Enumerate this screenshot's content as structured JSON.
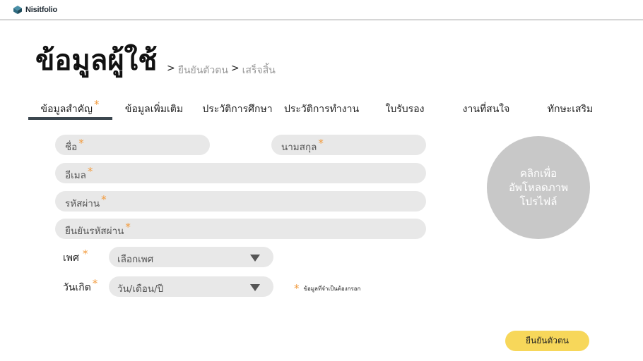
{
  "header": {
    "brand": "Nisitfolio"
  },
  "page": {
    "title": "ข้อมูลผู้ใช้",
    "breadcrumb": {
      "sep1": ">",
      "step1": "ยืนยันตัวตน",
      "sep2": ">",
      "step2": "เสร็จสิ้น"
    }
  },
  "tabs": [
    {
      "label": "ข้อมูลสำคัญ",
      "required": "*"
    },
    {
      "label": "ข้อมูลเพิ่มเติม"
    },
    {
      "label": "ประวัติการศึกษา"
    },
    {
      "label": "ประวัติการทำงาน"
    },
    {
      "label": "ใบรับรอง"
    },
    {
      "label": "งานที่สนใจ"
    },
    {
      "label": "ทักษะเสริม"
    }
  ],
  "form": {
    "first_name": {
      "placeholder": "ชื่อ"
    },
    "last_name": {
      "placeholder": "นามสกุล"
    },
    "email": {
      "placeholder": "อีเมล"
    },
    "password": {
      "placeholder": "รหัสผ่าน"
    },
    "confirm_password": {
      "placeholder": "ยืนยันรหัสผ่าน"
    },
    "gender": {
      "label": "เพศ",
      "value": "เลือกเพศ"
    },
    "birthdate": {
      "label": "วันเกิด",
      "value": "วัน/เดือน/ปี"
    },
    "required_mark": "*"
  },
  "avatar": {
    "line1": "คลิกเพื่อ",
    "line2": "อัพโหลดภาพ",
    "line3": "โปรไฟล์"
  },
  "required_note": {
    "star": "*",
    "text": "ข้อมูลที่จำเป็นต้องกรอก"
  },
  "actions": {
    "confirm": "ยืนยันตัวตน"
  },
  "colors": {
    "accent": "#f7d75a",
    "required": "#f29a3c",
    "field_bg": "#e8e8e8",
    "tab_underline": "#3c474f"
  }
}
